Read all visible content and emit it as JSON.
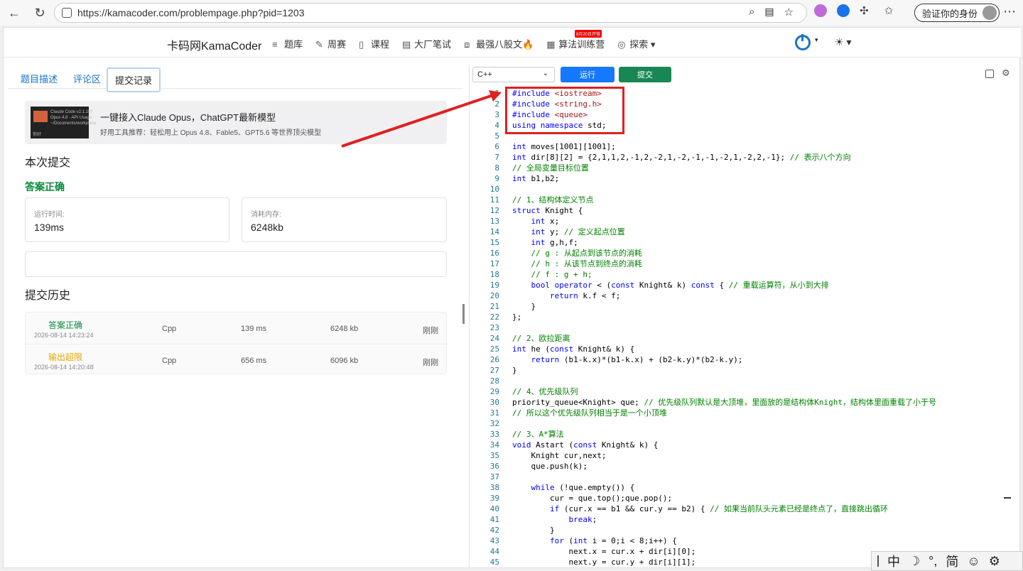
{
  "browser": {
    "url": "https://kamacoder.com/problempage.php?pid=1203",
    "verify_label": "验证你的身份"
  },
  "site": {
    "brand": "卡码网KamaCoder",
    "menu": [
      {
        "label": "题库",
        "icon": "list-icon"
      },
      {
        "label": "周赛",
        "icon": "pen-icon"
      },
      {
        "label": "课程",
        "icon": "book-icon"
      },
      {
        "label": "大厂笔试",
        "icon": "doc-icon"
      },
      {
        "label": "最强八股文🔥",
        "icon": "code-icon"
      },
      {
        "label": "算法训练营",
        "icon": "calendar-icon"
      },
      {
        "label": "探索",
        "icon": "compass-icon"
      }
    ],
    "badge": "8月20日开营"
  },
  "left": {
    "tabs": [
      "题目描述",
      "评论区",
      "提交记录"
    ],
    "ad": {
      "title": "一键接入Claude Opus，ChatGPT最新模型",
      "subtitle": "好用工具推荐：轻松用上 Opus 4.8、Fable5、GPT5.6 等世界顶尖模型",
      "img_text": "Claude Code v2.1.187\nOpus 4.8 · API Usage\n~/Documents/workplace",
      "img_foot": "你好"
    },
    "current_title": "本次提交",
    "result": "答案正确",
    "runtime_label": "运行时间:",
    "runtime_value": "139ms",
    "memory_label": "消耗内存:",
    "memory_value": "6248kb",
    "history_title": "提交历史",
    "history": [
      {
        "status": "答案正确",
        "color": "#0a8a3c",
        "time": "2026-08-14 14:23:24",
        "lang": "Cpp",
        "runtime": "139 ms",
        "memory": "6248 kb",
        "when": "刚刚"
      },
      {
        "status": "输出超限",
        "color": "#e6a700",
        "time": "2026-08-14 14:20:48",
        "lang": "Cpp",
        "runtime": "656 ms",
        "memory": "6096 kb",
        "when": "刚刚"
      }
    ]
  },
  "editor": {
    "language": "C++",
    "run_label": "运行",
    "submit_label": "提交",
    "lines": [
      "#include <iostream>",
      "#include <string.h>",
      "#include <queue>",
      "using namespace std;",
      "",
      "int moves[1001][1001];",
      "int dir[8][2] = {2,1,1,2,-1,2,-2,1,-2,-1,-1,-2,1,-2,2,-1}; // 表示八个方向",
      "// 全局变量目标位置",
      "int b1,b2;",
      "",
      "// 1、结构体定义节点",
      "struct Knight {",
      "    int x;",
      "    int y; // 定义起点位置",
      "    int g,h,f;",
      "    // g : 从起点到该节点的消耗",
      "    // h : 从该节点到终点的消耗",
      "    // f : g + h;",
      "    bool operator < (const Knight& k) const { // 重载运算符，从小到大排",
      "        return k.f < f;",
      "    }",
      "};",
      "",
      "// 2、欧拉距离",
      "int he (const Knight& k) {",
      "    return (b1-k.x)*(b1-k.x) + (b2-k.y)*(b2-k.y);",
      "}",
      "",
      "// 4、优先级队列",
      "priority_queue<Knight> que; // 优先级队列默认是大顶堆，里面放的是结构体Knight，结构体里面重载了小于号",
      "// 所以这个优先级队列相当于是一个小顶堆",
      "",
      "// 3、A*算法",
      "void Astart (const Knight& k) {",
      "    Knight cur,next;",
      "    que.push(k);",
      "",
      "    while (!que.empty()) {",
      "        cur = que.top();que.pop();",
      "        if (cur.x == b1 && cur.y == b2) { // 如果当前队头元素已经是终点了，直接跳出循环",
      "            break;",
      "        }",
      "        for (int i = 0;i < 8;i++) {",
      "            next.x = cur.x + dir[i][0];",
      "            next.y = cur.y + dir[i][1];"
    ]
  },
  "ime": [
    "中",
    "☽",
    "°,",
    "简",
    "☺",
    "⚙"
  ]
}
